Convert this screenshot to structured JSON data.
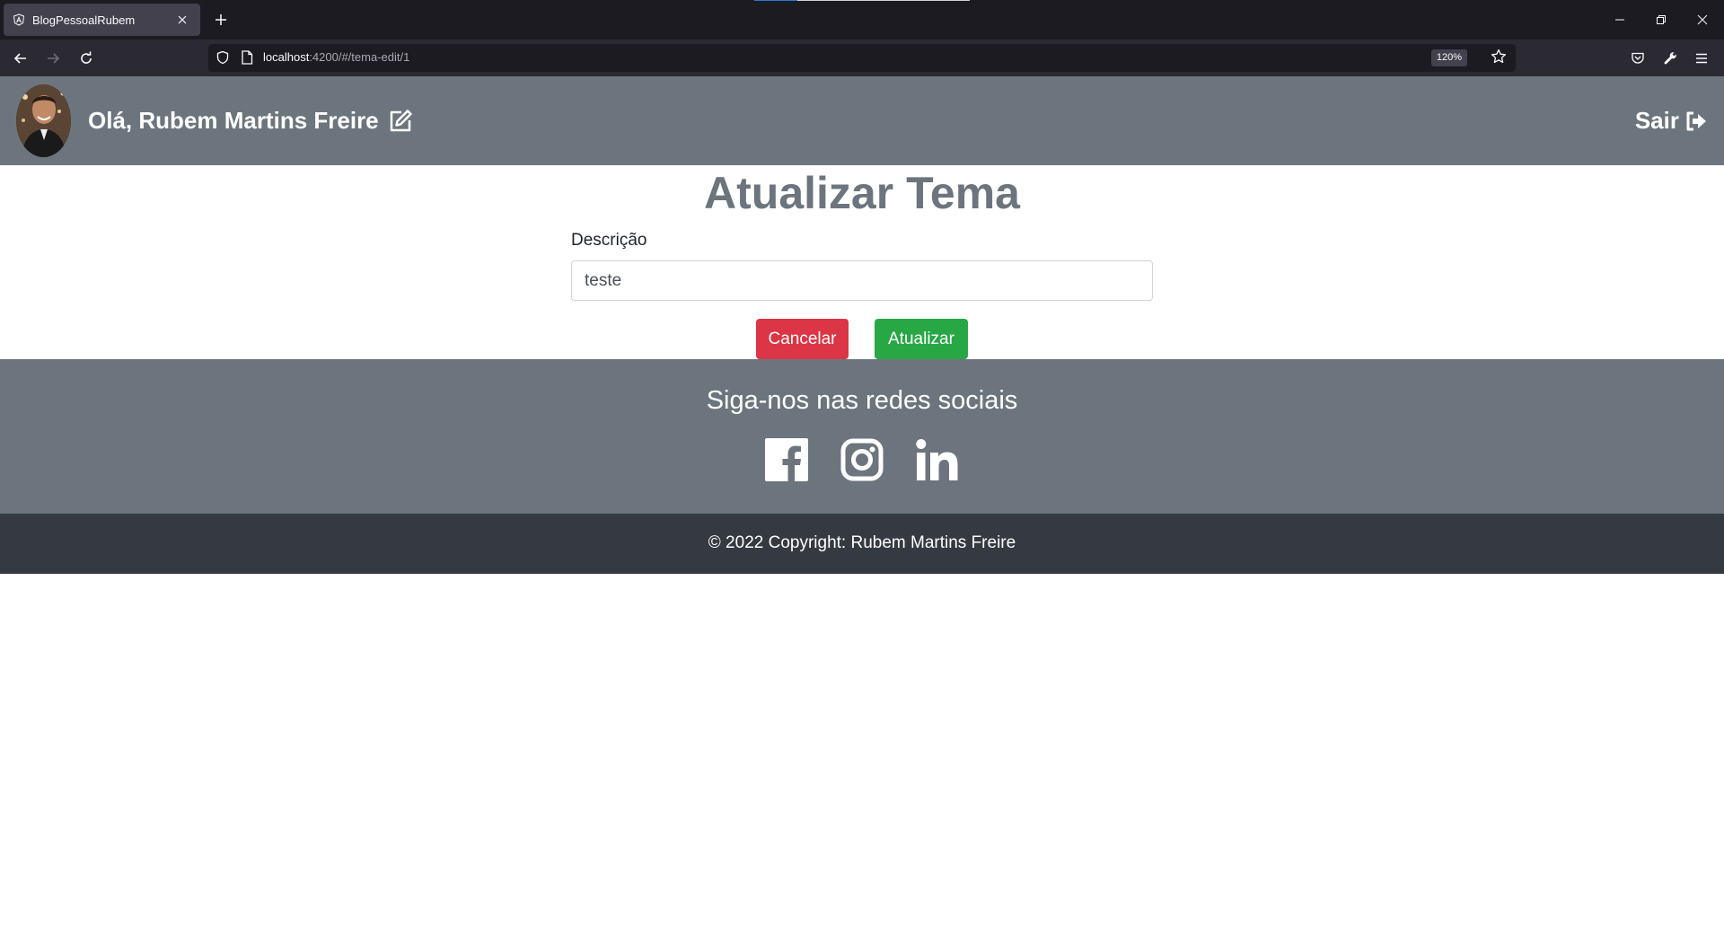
{
  "browser": {
    "tab": {
      "title": "BlogPessoalRubem",
      "favicon": "angular-logo-icon"
    },
    "url": {
      "host": "localhost",
      "path": ":4200/#/tema-edit/1"
    },
    "zoom": "120%"
  },
  "header": {
    "greeting": "Olá, Rubem Martins Freire",
    "logout_label": "Sair"
  },
  "form": {
    "title": "Atualizar Tema",
    "description_label": "Descrição",
    "description_value": "teste",
    "cancel_label": "Cancelar",
    "update_label": "Atualizar"
  },
  "social": {
    "title": "Siga-nos nas redes sociais",
    "icons": [
      "facebook-icon",
      "instagram-icon",
      "linkedin-icon"
    ]
  },
  "footer": {
    "copyright": "© 2022 Copyright: Rubem Martins Freire"
  },
  "colors": {
    "header_bg": "#6c757d",
    "footer_bg": "#343a40",
    "cancel": "#dc3545",
    "update": "#28a745"
  }
}
